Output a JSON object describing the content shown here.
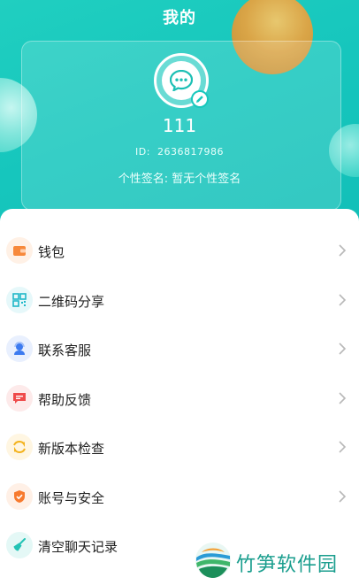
{
  "header": {
    "title": "我的"
  },
  "profile": {
    "username": "111",
    "id_label": "ID:",
    "id_value": "2636817986",
    "signature_label": "个性签名:",
    "signature_value": "暂无个性签名",
    "avatar_icon": "chat-bubble-icon",
    "edit_icon": "edit-pencil-icon"
  },
  "menu": {
    "items": [
      {
        "label": "钱包",
        "icon": "wallet-icon",
        "color": "#f7893b",
        "bg": "#fff1e6",
        "has_arrow": true
      },
      {
        "label": "二维码分享",
        "icon": "qrcode-icon",
        "color": "#1fb8c9",
        "bg": "#e6f8fa",
        "has_arrow": true
      },
      {
        "label": "联系客服",
        "icon": "customer-service-icon",
        "color": "#3d7bf0",
        "bg": "#e9f0fe",
        "has_arrow": true
      },
      {
        "label": "帮助反馈",
        "icon": "feedback-icon",
        "color": "#ef4a4a",
        "bg": "#fdeaea",
        "has_arrow": true
      },
      {
        "label": "新版本检查",
        "icon": "update-icon",
        "color": "#f3b21b",
        "bg": "#fff6e2",
        "has_arrow": true
      },
      {
        "label": "账号与安全",
        "icon": "shield-icon",
        "color": "#f77a2e",
        "bg": "#fff0e6",
        "has_arrow": true
      },
      {
        "label": "清空聊天记录",
        "icon": "broom-icon",
        "color": "#22c3b5",
        "bg": "#e4f8f6",
        "has_arrow": false
      }
    ]
  },
  "watermark": {
    "text": "竹笋软件园"
  }
}
